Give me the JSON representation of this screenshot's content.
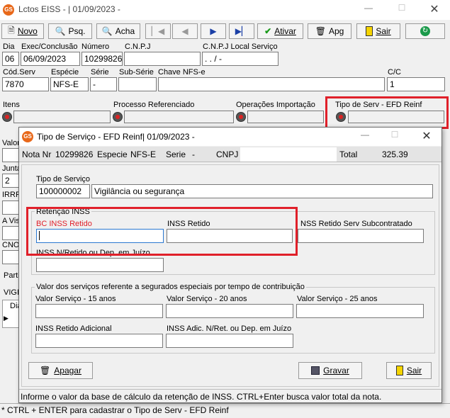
{
  "main_window": {
    "title": "Lctos EISS - |  01/09/2023 -",
    "logo_text": "GS",
    "toolbar": {
      "novo": "Novo",
      "psq": "Psq.",
      "acha": "Acha",
      "ativar": "Ativar",
      "apg": "Apg",
      "sair": "Sair"
    },
    "labels": {
      "dia": "Dia",
      "exec": "Exec/Conclusão",
      "numero": "Número",
      "cnpj": "C.N.P.J",
      "cnpj_local": "C.N.P.J Local Serviço",
      "cod_serv": "Cód.Serv",
      "especie": "Espécie",
      "serie": "Série",
      "sub_serie": "Sub-Série",
      "chave": "Chave NFS-e",
      "cc": "C/C",
      "itens": "Itens",
      "processo": "Processo Referenciado",
      "operacoes": "Operações Importação",
      "tipo_serv": "Tipo de Serv - EFD Reinf",
      "valor": "Valor",
      "junta": "Junta",
      "irrf": "IRRF",
      "a_vista": "A Vis",
      "cno": "CNO",
      "partic": "Partic",
      "vigil": "VIGIL",
      "dia_col": "Dia"
    },
    "values": {
      "dia": "06",
      "exec": "06/09/2023",
      "numero": "10299826",
      "cnpj_local": ".   .   /   -",
      "cod_serv": "7870",
      "especie": "NFS-E",
      "serie": "-",
      "cc": "1",
      "junta": "2"
    },
    "status": "* CTRL + ENTER para  cadastrar o Tipo de Serv - EFD Reinf"
  },
  "dialog": {
    "title": "Tipo de Serviço - EFD Reinf|  01/09/2023 -",
    "header": {
      "nota_label": "Nota Nr",
      "nota_value": "10299826",
      "especie_label": "Especie",
      "especie_value": "NFS-E",
      "serie_label": "Serie",
      "serie_value": "-",
      "cnpj_label": "CNPJ",
      "total_label": "Total",
      "total_value": "325.39"
    },
    "tipo_servico_label": "Tipo de Serviço",
    "tipo_servico_code": "100000002",
    "tipo_servico_desc": "Vigilância ou segurança",
    "retencao_group": "Retenção INSS",
    "bc_inss_label": "BC INSS Retido",
    "inss_retido_label": "INSS Retido",
    "inss_sub_label": "NSS Retido Serv Subcontratado",
    "inss_nretido_label": "INSS N/Retido ou Dep. em Juízo",
    "valor_group": "Valor dos serviços referente a segurados especiais por tempo de contribuição",
    "vs15_label": "Valor Serviço - 15 anos",
    "vs20_label": "Valor Serviço - 20 anos",
    "vs25_label": "Valor Serviço - 25 anos",
    "inss_adic_label": "INSS Retido Adicional",
    "inss_adic_nret_label": "INSS Adic. N/Ret. ou Dep. em Juízo",
    "apagar": "Apagar",
    "gravar": "Gravar",
    "sair": "Sair",
    "status": "Informe o valor da base de cálculo da retenção de INSS. CTRL+Enter busca valor total da nota."
  },
  "colors": {
    "highlight": "#e0202a",
    "logo": "#e8681a"
  }
}
